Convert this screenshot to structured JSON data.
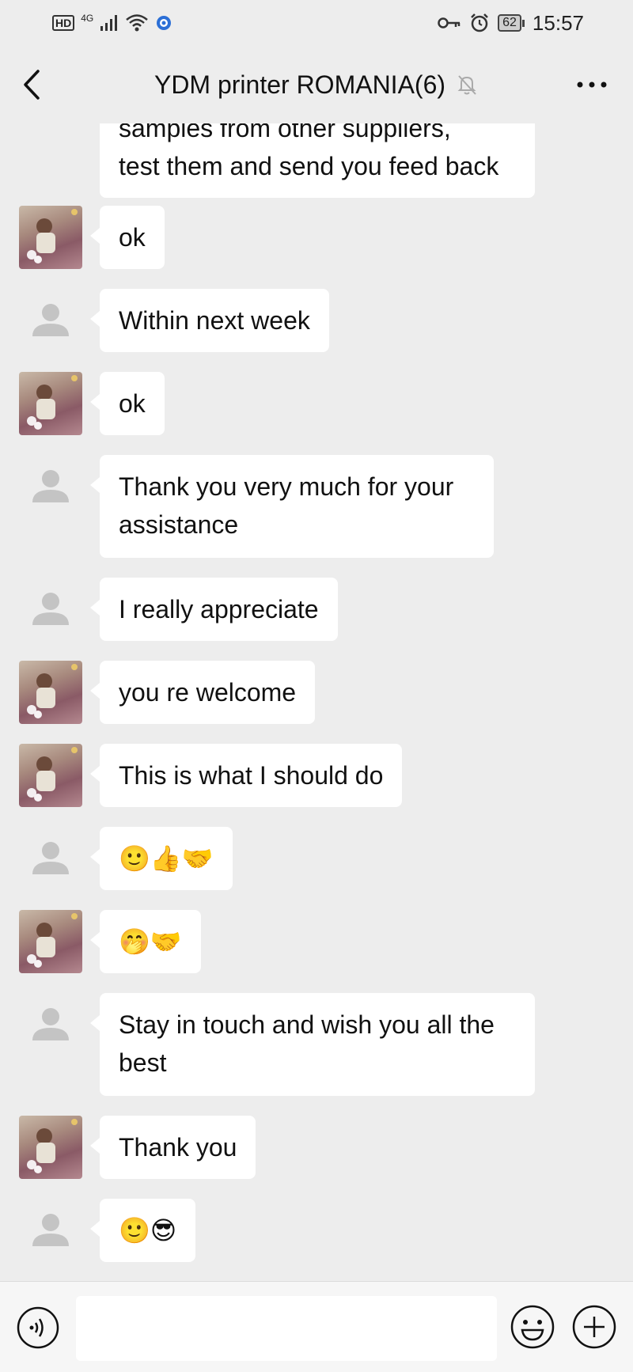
{
  "status_bar": {
    "hd_label": "HD",
    "network_label": "4G",
    "battery_level": "62",
    "time": "15:57"
  },
  "header": {
    "title": "YDM printer ROMANIA(6)",
    "back_icon": "chevron-left-icon",
    "mute_icon": "bell-off-icon",
    "more_icon": "more-dots-icon"
  },
  "messages": [
    {
      "sender": "other",
      "text": "samples from other suppliers,\ntest them and send you feed back"
    },
    {
      "sender": "photo",
      "text": "ok"
    },
    {
      "sender": "default",
      "text": "Within next week"
    },
    {
      "sender": "photo",
      "text": "ok"
    },
    {
      "sender": "default",
      "text": "Thank you very much for your\nassistance"
    },
    {
      "sender": "default",
      "text": "I really appreciate"
    },
    {
      "sender": "photo",
      "text": "you re welcome"
    },
    {
      "sender": "photo",
      "text": "This is what I should do"
    },
    {
      "sender": "default",
      "text": "🙂👍🤝"
    },
    {
      "sender": "photo",
      "text": "🤭🤝"
    },
    {
      "sender": "default",
      "text": "Stay in touch and wish you all the\nbest"
    },
    {
      "sender": "photo",
      "text": "Thank you"
    },
    {
      "sender": "default",
      "text": "🙂😎"
    }
  ],
  "input_bar": {
    "voice_icon": "voice-icon",
    "message_value": "",
    "emoji_icon": "emoji-icon",
    "plus_icon": "plus-icon"
  },
  "colors": {
    "background": "#ededed",
    "bubble": "#ffffff",
    "input_bar": "#f6f6f6"
  }
}
